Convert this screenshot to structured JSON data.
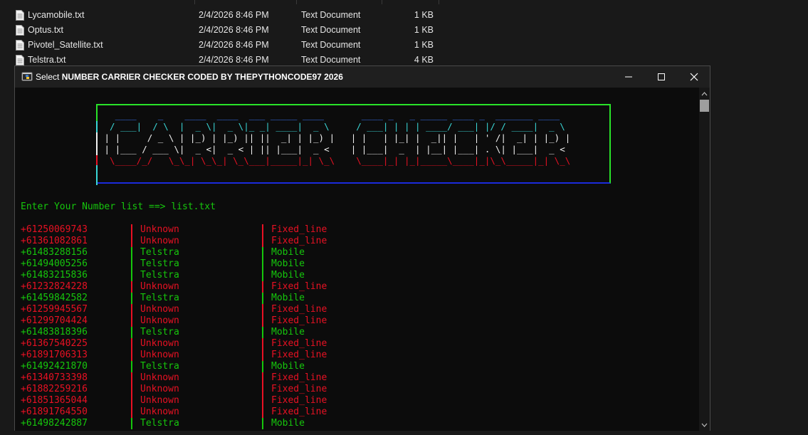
{
  "explorer": {
    "files": [
      {
        "name": "Lycamobile.txt",
        "date": "2/4/2026 8:46 PM",
        "type": "Text Document",
        "size": "1 KB"
      },
      {
        "name": "Optus.txt",
        "date": "2/4/2026 8:46 PM",
        "type": "Text Document",
        "size": "1 KB"
      },
      {
        "name": "Pivotel_Satellite.txt",
        "date": "2/4/2026 8:46 PM",
        "type": "Text Document",
        "size": "1 KB"
      },
      {
        "name": "Telstra.txt",
        "date": "2/4/2026 8:46 PM",
        "type": "Text Document",
        "size": "4 KB"
      }
    ]
  },
  "console": {
    "title_prefix": "Select ",
    "title_bold": "NUMBER CARRIER CHECKER CODED BY THEPYTHONCODE97 2026",
    "banner_lines": [
      {
        "text": "   ____    _    ____  ____  ___ _____ ____       ____ _   _ _____ ____ _  _______ ____  ",
        "color": "#3b78ff"
      },
      {
        "text": "  / ___|  / \\  |  _ \\|  _ \\|_ _| ____|  _ \\     / ___| | | | ____/ ___| |/ / ____|  _ \\ ",
        "color": "#3ad7d7"
      },
      {
        "text": " | |     / _ \\ | |_) | |_) || ||  _| | |_) |   | |   | |_| |  _|| |   | ' /|  _| | |_) |",
        "color": "#f2f2f2"
      },
      {
        "text": " | |___ / ___ \\|  _ <|  _ < | || |___|  _ <    | |___|  _  | |__| |___| . \\| |___|  _ < ",
        "color": "#f2f2f2"
      },
      {
        "text": "  \\____/_/   \\_\\_| \\_\\_| \\_\\___|_____|_| \\_\\    \\____|_| |_|_____\\____|_|\\_\\_____|_| \\_\\",
        "color": "#e81123"
      }
    ],
    "prompt_label": "Enter Your Number list ==> ",
    "prompt_value": "list.txt",
    "colors": {
      "ok": "#16c60c",
      "bad": "#e81123"
    },
    "results": [
      {
        "number": "+61250069743",
        "carrier": "Unknown",
        "line_type": "Fixed_line",
        "status": "bad"
      },
      {
        "number": "+61361082861",
        "carrier": "Unknown",
        "line_type": "Fixed_line",
        "status": "bad"
      },
      {
        "number": "+61483288156",
        "carrier": "Telstra",
        "line_type": "Mobile",
        "status": "ok"
      },
      {
        "number": "+61494005256",
        "carrier": "Telstra",
        "line_type": "Mobile",
        "status": "ok"
      },
      {
        "number": "+61483215836",
        "carrier": "Telstra",
        "line_type": "Mobile",
        "status": "ok"
      },
      {
        "number": "+61232824228",
        "carrier": "Unknown",
        "line_type": "Fixed_line",
        "status": "bad"
      },
      {
        "number": "+61459842582",
        "carrier": "Telstra",
        "line_type": "Mobile",
        "status": "ok"
      },
      {
        "number": "+61259945567",
        "carrier": "Unknown",
        "line_type": "Fixed_line",
        "status": "bad"
      },
      {
        "number": "+61299704424",
        "carrier": "Unknown",
        "line_type": "Fixed_line",
        "status": "bad"
      },
      {
        "number": "+61483818396",
        "carrier": "Telstra",
        "line_type": "Mobile",
        "status": "ok"
      },
      {
        "number": "+61367540225",
        "carrier": "Unknown",
        "line_type": "Fixed_line",
        "status": "bad"
      },
      {
        "number": "+61891706313",
        "carrier": "Unknown",
        "line_type": "Fixed_line",
        "status": "bad"
      },
      {
        "number": "+61492421870",
        "carrier": "Telstra",
        "line_type": "Mobile",
        "status": "ok"
      },
      {
        "number": "+61340733398",
        "carrier": "Unknown",
        "line_type": "Fixed_line",
        "status": "bad"
      },
      {
        "number": "+61882259216",
        "carrier": "Unknown",
        "line_type": "Fixed_line",
        "status": "bad"
      },
      {
        "number": "+61851365044",
        "carrier": "Unknown",
        "line_type": "Fixed_line",
        "status": "bad"
      },
      {
        "number": "+61891764550",
        "carrier": "Unknown",
        "line_type": "Fixed_line",
        "status": "bad"
      },
      {
        "number": "+61498242887",
        "carrier": "Telstra",
        "line_type": "Mobile",
        "status": "ok"
      }
    ]
  }
}
